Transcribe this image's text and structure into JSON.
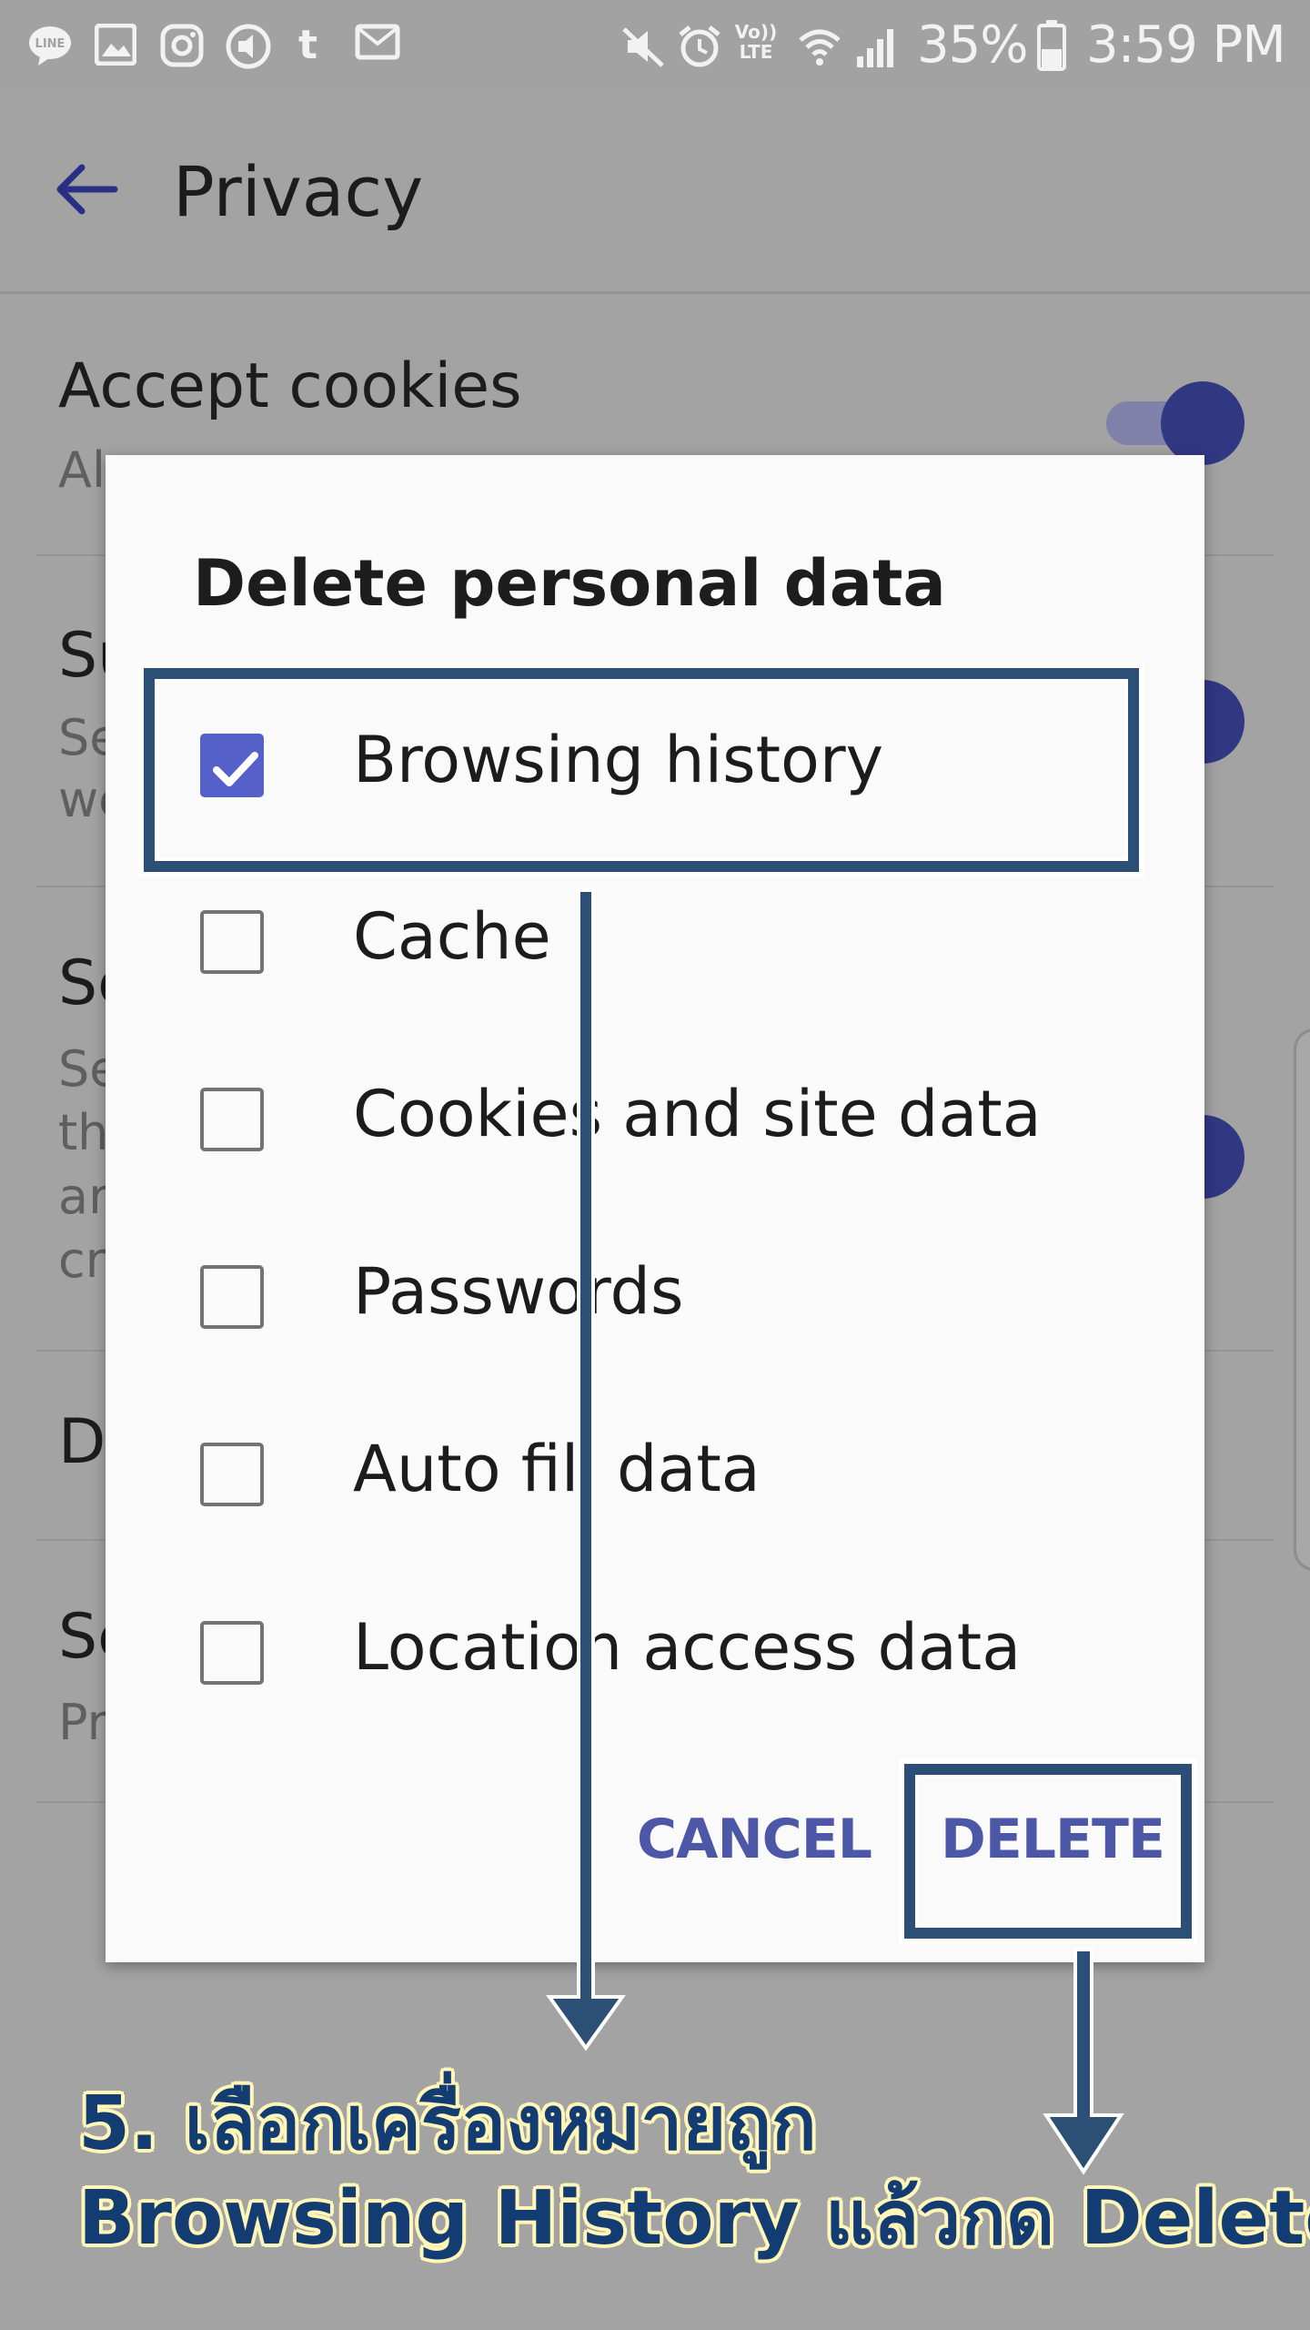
{
  "status_bar": {
    "left_icons": [
      "line-icon",
      "gallery-icon",
      "instagram-icon",
      "music-icon",
      "tumblr-icon",
      "mail-icon"
    ],
    "right_icons": [
      "mute-icon",
      "alarm-icon",
      "volte-icon",
      "wifi-icon",
      "signal-icon",
      "battery-icon"
    ],
    "volte_label": "Vo)) LTE",
    "battery": "35%",
    "time": "3:59 PM"
  },
  "app_bar": {
    "title": "Privacy"
  },
  "settings": [
    {
      "title": "Accept cookies",
      "subtitle": "Al"
    },
    {
      "title": "Su",
      "subtitle_lines": [
        "Se",
        "we"
      ]
    },
    {
      "title": "Se",
      "subtitle_lines": [
        "Se",
        "th",
        "ar",
        "cr"
      ]
    },
    {
      "title": "D"
    },
    {
      "title": "Se",
      "subtitle": "Pr"
    }
  ],
  "dialog": {
    "title": "Delete personal data",
    "options": [
      {
        "label": "Browsing history",
        "checked": true
      },
      {
        "label": "Cache",
        "checked": false
      },
      {
        "label": "Cookies and site data",
        "checked": false
      },
      {
        "label": "Passwords",
        "checked": false
      },
      {
        "label": "Auto fill data",
        "checked": false
      },
      {
        "label": "Location access data",
        "checked": false
      }
    ],
    "cancel_label": "CANCEL",
    "delete_label": "DELETE"
  },
  "annotation": {
    "line1": "5. เลือกเครื่องหมายถูก",
    "line2": "Browsing History แล้วกด Delete"
  },
  "colors": {
    "accent": "#5560c9",
    "button_text": "#4d57a8",
    "annotation_box": "#2c5075",
    "caption_text": "#133c72",
    "caption_outline": "#fff6b8"
  }
}
